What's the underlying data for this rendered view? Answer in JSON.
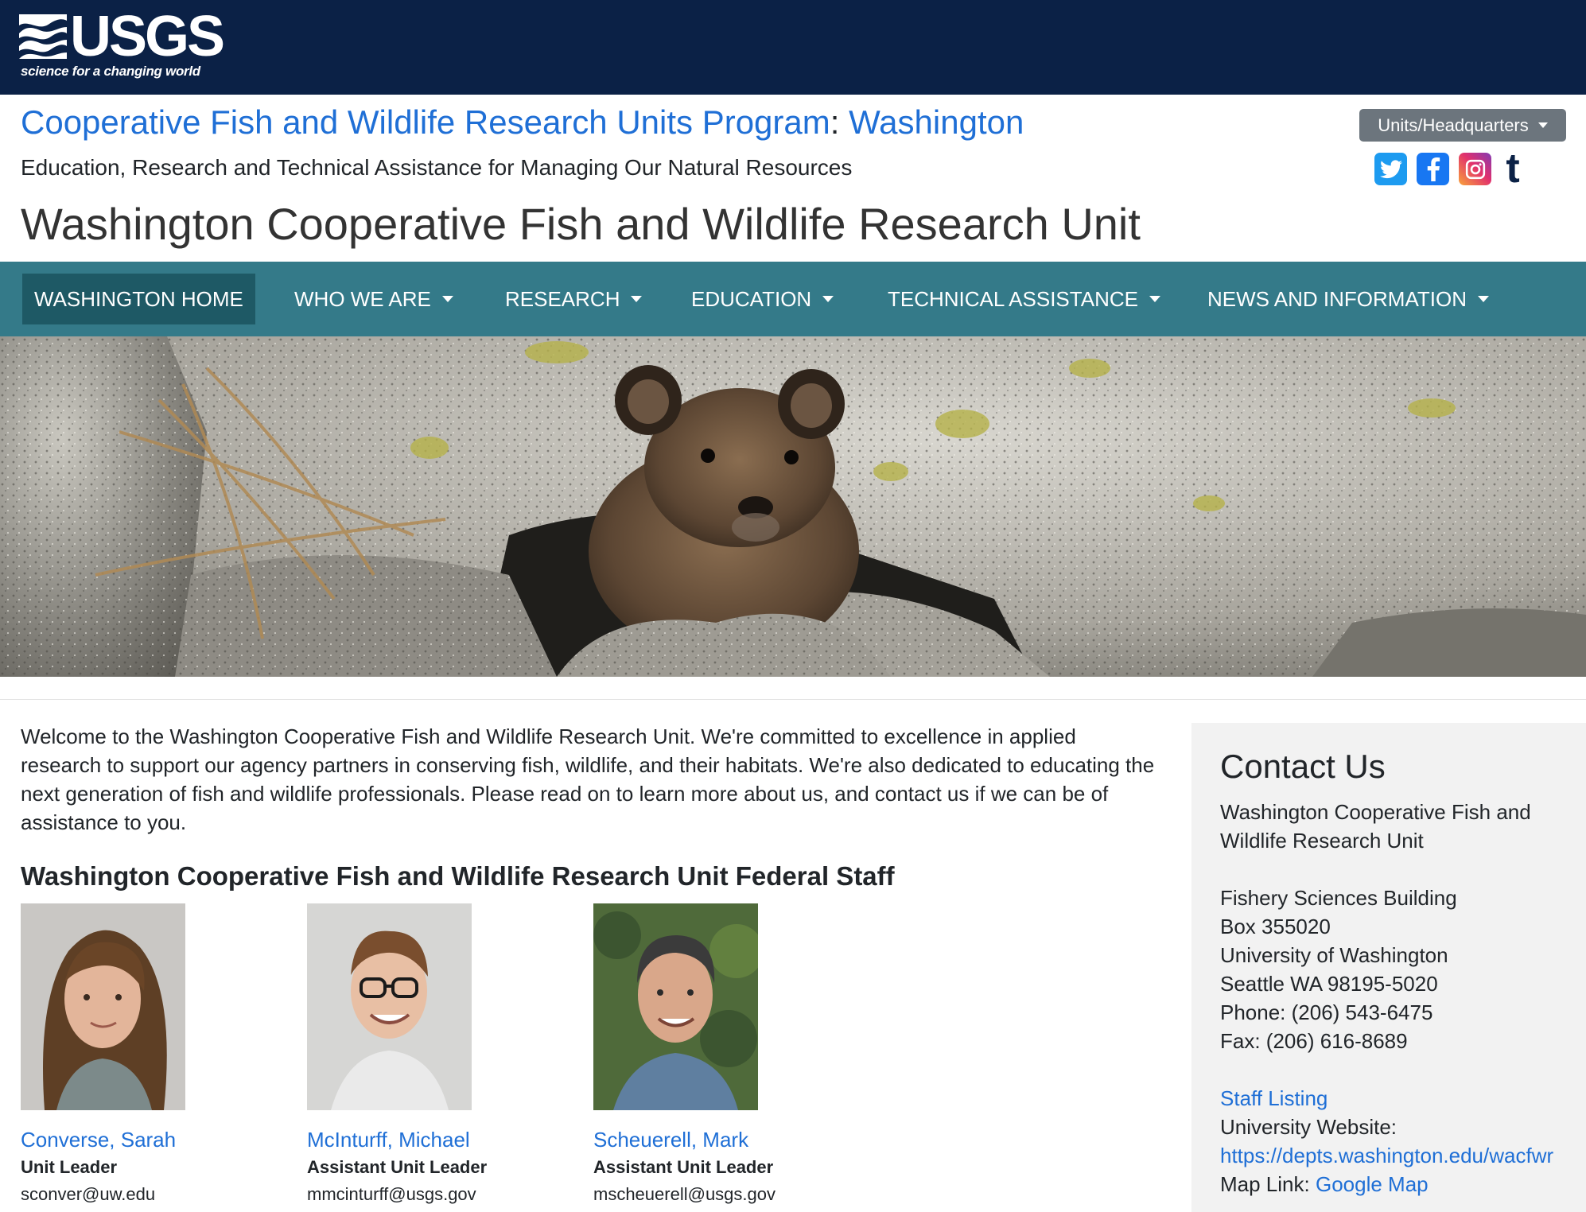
{
  "header": {
    "logo_text": "USGS",
    "logo_tagline": "science for a changing world",
    "program_link": "Cooperative Fish and Wildlife Research Units Program",
    "separator": ":",
    "state_link": "Washington",
    "tagline": "Education, Research and Technical Assistance for Managing Our Natural Resources",
    "unit_title": "Washington Cooperative Fish and Wildlife Research Unit",
    "units_button": "Units/Headquarters"
  },
  "social": [
    "twitter-icon",
    "facebook-icon",
    "instagram-icon",
    "tumblr-icon"
  ],
  "social_tumblr_glyph": "t",
  "nav": {
    "items": [
      {
        "label": "WASHINGTON HOME"
      },
      {
        "label": "WHO WE ARE"
      },
      {
        "label": "RESEARCH"
      },
      {
        "label": "EDUCATION"
      },
      {
        "label": "TECHNICAL ASSISTANCE"
      },
      {
        "label": "NEWS AND INFORMATION"
      }
    ]
  },
  "main": {
    "intro": "Welcome to the Washington Cooperative Fish and Wildlife Research Unit. We're committed to excellence in applied research to support our agency partners in conserving fish, wildlife, and their habitats. We're also dedicated to educating the next generation of fish and wildlife professionals. Please read on to learn more about us, and contact us if we can be of assistance to you.",
    "staff_heading": "Washington Cooperative Fish and Wildlife Research Unit Federal Staff",
    "staff": [
      {
        "name": "Converse, Sarah",
        "role": "Unit Leader",
        "email": "sconver@uw.edu"
      },
      {
        "name": "McInturff, Michael",
        "role": "Assistant Unit Leader",
        "email": "mmcinturff@usgs.gov"
      },
      {
        "name": "Scheuerell, Mark",
        "role": "Assistant Unit Leader",
        "email": "mscheuerell@usgs.gov"
      }
    ]
  },
  "contact": {
    "heading": "Contact Us",
    "org_line1": "Washington Cooperative Fish and",
    "org_line2": "Wildlife Research Unit",
    "building": "Fishery Sciences Building",
    "box": "Box 355020",
    "university": "University of Washington",
    "city": "Seattle WA 98195-5020",
    "phone": "Phone: (206) 543-6475",
    "fax": "Fax: (206) 616-8689",
    "staff_listing": "Staff Listing",
    "university_website_label": "University Website:",
    "university_website_url": "https://depts.washington.edu/wacfwr",
    "map_label": "Map Link:",
    "map_link": "Google Map"
  },
  "colors": {
    "top_bar": "#0b2146",
    "nav": "#347a89",
    "nav_active": "#1e5965",
    "link": "#1f6fd6"
  }
}
